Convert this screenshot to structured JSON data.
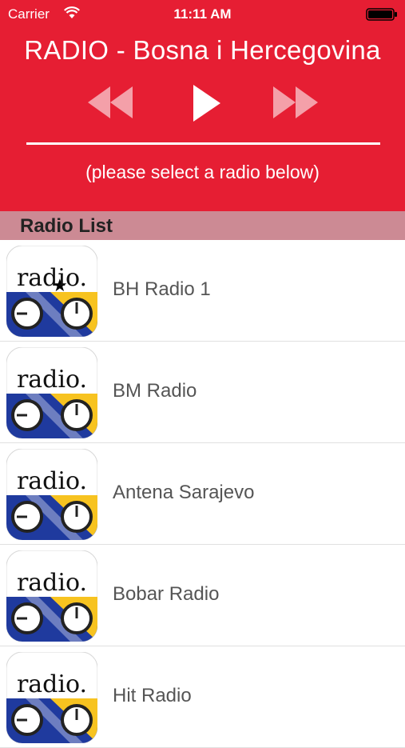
{
  "status_bar": {
    "carrier": "Carrier",
    "time": "11:11 AM"
  },
  "header": {
    "title": "RADIO - Bosna i Hercegovina",
    "hint": "(please select a radio below)",
    "controls": [
      "rewind-icon",
      "play-icon",
      "fast-forward-icon"
    ],
    "accent_color": "#e61e33"
  },
  "section": {
    "title": "Radio List"
  },
  "icon_text": "radio.",
  "stations": [
    {
      "name": "BH Radio 1"
    },
    {
      "name": "BM Radio"
    },
    {
      "name": "Antena Sarajevo"
    },
    {
      "name": "Bobar Radio"
    },
    {
      "name": "Hit Radio"
    }
  ]
}
